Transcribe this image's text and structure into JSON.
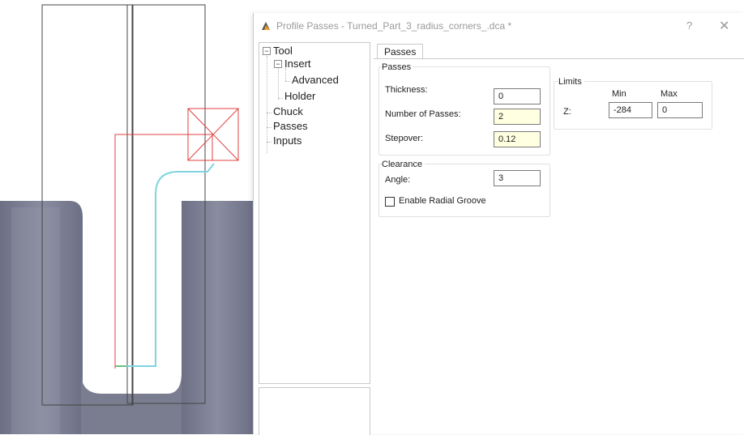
{
  "dialog": {
    "title": "Profile Passes - Turned_Part_3_radius_corners_.dca *",
    "help_symbol": "?",
    "close_symbol": "✕"
  },
  "tree": {
    "items": [
      {
        "label": "Tool",
        "expander": "−"
      },
      {
        "label": "Insert",
        "expander": "−"
      },
      {
        "label": "Advanced"
      },
      {
        "label": "Holder"
      },
      {
        "label": "Chuck"
      },
      {
        "label": "Passes"
      },
      {
        "label": "Inputs"
      }
    ]
  },
  "tabs": [
    {
      "label": "Passes"
    }
  ],
  "passes_group": {
    "title": "Passes",
    "thickness_label": "Thickness:",
    "thickness_value": "0",
    "num_passes_label": "Number of Passes:",
    "num_passes_value": "2",
    "stepover_label": "Stepover:",
    "stepover_value": "0.12"
  },
  "limits_group": {
    "title": "Limits",
    "min_header": "Min",
    "max_header": "Max",
    "z_label": "Z:",
    "z_min": "-284",
    "z_max": "0"
  },
  "clearance_group": {
    "title": "Clearance",
    "angle_label": "Angle:",
    "angle_value": "3",
    "radial_groove_label": "Enable Radial Groove",
    "radial_groove_checked": false
  },
  "colors": {
    "part_gray": "#7c7f91",
    "toolpath_cyan": "#7fd4e0",
    "boundary_red": "#e04040",
    "field_highlight": "#ffffe1"
  }
}
